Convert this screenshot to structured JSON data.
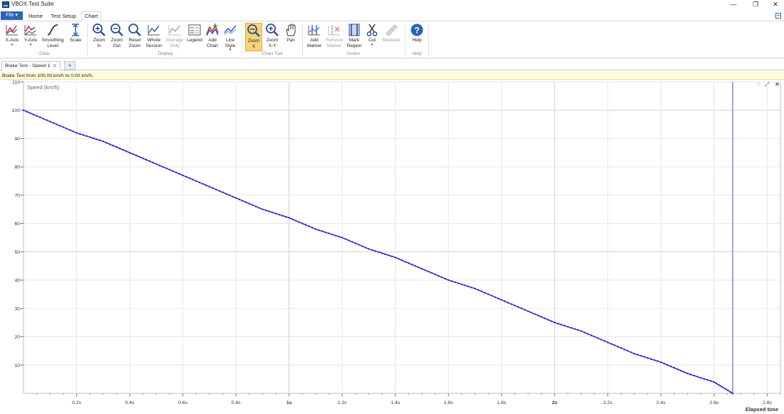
{
  "window": {
    "title": "VBOX Test Suite",
    "minimize_glyph": "—",
    "maximize_glyph": "❐",
    "close_glyph": "✕"
  },
  "ribbon_tabs": {
    "file": "File ▾",
    "home": "Home",
    "test_setup": "Test Setup",
    "chart": "Chart"
  },
  "ribbon": {
    "groups": {
      "data": "Data",
      "display": "Display",
      "chart_tool": "Chart Tool",
      "action": "Action",
      "help": "Help"
    },
    "buttons": {
      "x_axis": "X-Axis",
      "y_axis": "Y-Axis",
      "smoothing": "Smoothing\nLevel",
      "scale": "Scale",
      "zoom_in": "Zoom\nIn",
      "zoom_out": "Zoom\nOut",
      "reset_zoom": "Reset\nZoom",
      "whole_session": "Whole\nSession",
      "average_only": "Average\nOnly",
      "legend": "Legend",
      "add_chart": "Add\nChart",
      "line_style": "Line\nStyle",
      "zoom_x": "Zoom\nX",
      "zoom_xy": "Zoom\nX-Y",
      "pan": "Pan",
      "add_marker": "Add\nMarker",
      "remove_marker": "Remove\nMarker",
      "mark_region": "Mark\nRegion",
      "cut": "Cut",
      "measure": "Measure",
      "help": "Help"
    },
    "caret": "▾"
  },
  "doc_tabs": {
    "active": "Brake Test - Speed 1",
    "close": "✕",
    "add": "+"
  },
  "info_bar": {
    "text": "Brake Test from 100.00 km/h to 0.00 km/h."
  },
  "colors": {
    "series": "#3a1fd0",
    "marker": "#7a5ad8",
    "grid": "#e6e6e6",
    "accent": "#2b63b6"
  },
  "chart_data": {
    "type": "line",
    "title": "",
    "ylabel": "Speed (km/h)",
    "xlabel": "Elapsed time",
    "xlim": [
      0,
      2.85
    ],
    "ylim": [
      0,
      110
    ],
    "yticks": [
      10,
      20,
      30,
      40,
      50,
      60,
      70,
      80,
      90,
      100,
      110
    ],
    "ytick_labels": [
      "10",
      "20",
      "30",
      "40",
      "50",
      "60",
      "70",
      "80",
      "90",
      "100",
      "110"
    ],
    "xticks": [
      0.2,
      0.4,
      0.6,
      0.8,
      1.0,
      1.2,
      1.4,
      1.6,
      1.8,
      2.0,
      2.2,
      2.4,
      2.6,
      2.8
    ],
    "xtick_labels": [
      "0.2s",
      "0.4s",
      "0.6s",
      "0.8s",
      "1s",
      "1.2s",
      "1.4s",
      "1.6s",
      "1.8s",
      "2s",
      "2.2s",
      "2.4s",
      "2.6s",
      "2.8s"
    ],
    "marker_x": 2.67,
    "grid": true,
    "series": [
      {
        "x": [
          0.0,
          0.1,
          0.2,
          0.3,
          0.4,
          0.5,
          0.6,
          0.7,
          0.8,
          0.9,
          1.0,
          1.1,
          1.2,
          1.3,
          1.4,
          1.5,
          1.6,
          1.7,
          1.8,
          1.9,
          2.0,
          2.1,
          2.2,
          2.3,
          2.4,
          2.5,
          2.6,
          2.67
        ],
        "values": [
          100,
          96,
          92,
          89,
          85,
          81,
          77,
          73,
          69,
          65,
          62,
          58,
          55,
          51,
          48,
          44,
          40,
          37,
          33,
          29,
          25,
          22,
          18,
          14,
          11,
          7,
          4,
          0
        ]
      }
    ]
  }
}
